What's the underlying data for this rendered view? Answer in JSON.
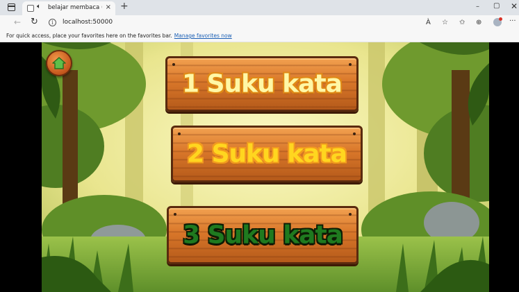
{
  "browser": {
    "tab_title": "belajar membaca (Construct",
    "tab_close": "×",
    "new_tab": "+",
    "url": "localhost:50000",
    "info_icon": "i",
    "favorites_prompt": "For quick access, place your favorites here on the favorites bar.",
    "favorites_link": "Manage favorites now",
    "window": {
      "minimize": "–",
      "maximize": "▢",
      "close": "✕"
    },
    "toolbar_icons": {
      "read_aloud": "À",
      "favorite_add": "☆",
      "favorites": "✩",
      "collections": "⊕",
      "more": "···"
    }
  },
  "game": {
    "home_button": "home-icon",
    "options": [
      {
        "label": "1 Suku kata"
      },
      {
        "label": "2 Suku kata"
      },
      {
        "label": "3 Suku kata"
      }
    ]
  },
  "colors": {
    "plank_wood": "#d9772a",
    "plank_border": "#5a2a0e",
    "label1": "#fff7a6",
    "label2": "#ffd61f",
    "label3": "#1f7a1f",
    "jungle_sky": "#f4f0a8"
  }
}
